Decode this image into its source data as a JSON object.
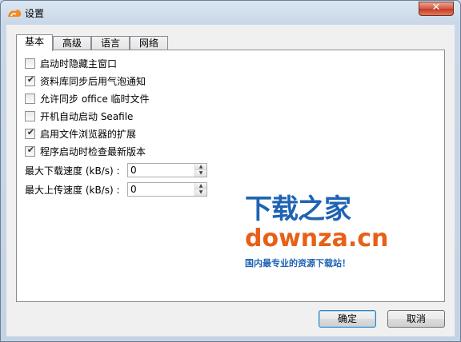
{
  "window": {
    "title": "设置",
    "close_glyph": "✕"
  },
  "tabs": [
    {
      "label": "基本",
      "active": true
    },
    {
      "label": "高级",
      "active": false
    },
    {
      "label": "语言",
      "active": false
    },
    {
      "label": "网络",
      "active": false
    }
  ],
  "checkboxes": [
    {
      "label": "启动时隐藏主窗口",
      "checked": false
    },
    {
      "label": "资料库同步后用气泡通知",
      "checked": true
    },
    {
      "label": "允许同步 office 临时文件",
      "checked": false
    },
    {
      "label": "开机自动启动 Seafile",
      "checked": false
    },
    {
      "label": "启用文件浏览器的扩展",
      "checked": true
    },
    {
      "label": "程序启动时检查最新版本",
      "checked": true
    }
  ],
  "fields": [
    {
      "label": "最大下载速度 (kB/s) :",
      "value": "0"
    },
    {
      "label": "最大上传速度 (kB/s) :",
      "value": "0"
    }
  ],
  "watermark": {
    "cn": "下载之家",
    "en": "downza.cn",
    "sub": "国内最专业的资源下载站！"
  },
  "buttons": {
    "ok": "确定",
    "cancel": "取消"
  },
  "colors": {
    "accent_blue": "#1f63b3",
    "accent_orange": "#e85f17",
    "close_red": "#c53a23"
  }
}
